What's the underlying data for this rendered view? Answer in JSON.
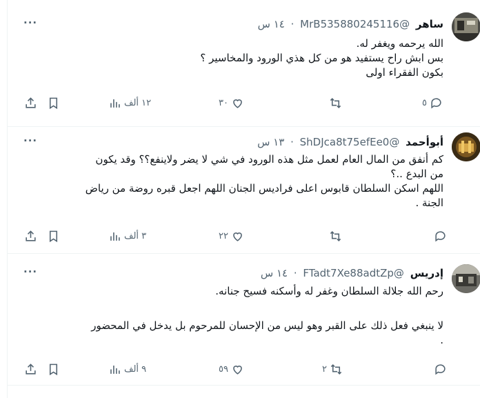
{
  "tweets": [
    {
      "name": "ساهر",
      "handle": "@MrB535880245116",
      "time": "١٤ س",
      "lines": [
        "الله يرحمه ويغفر له.",
        "بس ابش راح يستفيد هو من كل هذي الورود والمخاسير ؟",
        "بكون الفقراء اولى"
      ],
      "replies": "٥",
      "retweets": "",
      "likes": "٣٠",
      "views": "١٢ ألف"
    },
    {
      "name": "أبوأحمد",
      "handle": "@ShDJca8t75efEe0",
      "time": "١٣ س",
      "lines": [
        "كم أنفق من المال العام لعمل مثل هذه الورود في شي لا يضر ولاينفع؟؟ وقد يكون",
        "من البدع ..؟",
        "اللهم اسكن السلطان قابوس اعلى فراديس الجنان اللهم اجعل قبره روضة من رياض",
        "الجنة ."
      ],
      "replies": "",
      "retweets": "",
      "likes": "٢٢",
      "views": "٣ ألف"
    },
    {
      "name": "إدريس",
      "handle": "@FTadt7Xe88adtZp",
      "time": "١٤ س",
      "lines": [
        "رحم الله جلالة السلطان وغفر له وأسكنه فسيح جنانه.",
        "",
        "لا ينبغي فعل ذلك على القبر وهو ليس من الإحسان للمرحوم بل يدخل في المحضور",
        "."
      ],
      "replies": "",
      "retweets": "٢",
      "likes": "٥٩",
      "views": "٩ ألف"
    }
  ],
  "separator": "·",
  "more_label": "···",
  "icons": [
    "reply-icon",
    "retweet-icon",
    "like-icon",
    "views-icon",
    "bookmark-icon",
    "share-icon"
  ],
  "colors": {
    "text": "#0f1419",
    "secondary": "#536471",
    "border": "#eff3f4"
  }
}
